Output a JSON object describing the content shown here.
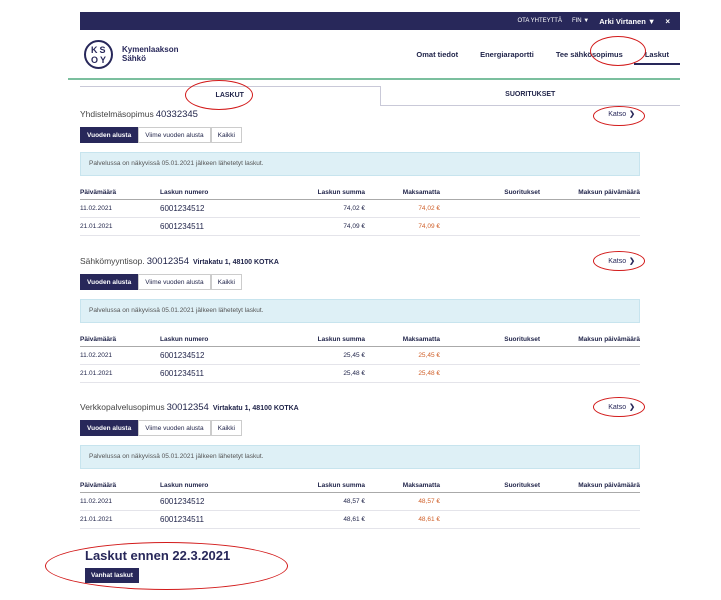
{
  "topbar": {
    "contact": "OTA YHTEYTTÄ",
    "lang": "FIN",
    "user": "Arki Virtanen",
    "close": "×"
  },
  "brand": {
    "logo_mark_top": "KS",
    "logo_mark_bottom": "OY",
    "name_line1": "Kymenlaakson",
    "name_line2": "Sähkö"
  },
  "nav": [
    "Omat tiedot",
    "Energiaraportti",
    "Tee sähkösopimus",
    "Laskut"
  ],
  "tabs": {
    "invoices": "LASKUT",
    "payments": "SUORITUKSET"
  },
  "icons": {
    "chevron": "chevron-down-icon",
    "caret": "caret-down-icon",
    "close": "close-icon"
  },
  "colors": {
    "brand": "#28285a",
    "accent_green": "#7bbf9e",
    "due": "#d0602a",
    "annotation": "#d21a1a",
    "info_bg": "#def0f6"
  },
  "filters": [
    "Vuoden alusta",
    "Viime vuoden alusta",
    "Kaikki"
  ],
  "columns": [
    "Päivämäärä",
    "Laskun numero",
    "Laskun summa",
    "Maksamatta",
    "Suoritukset",
    "Maksun päivämäärä"
  ],
  "katso": "Katso",
  "sections": [
    {
      "label": "Yhdistelmäsopimus",
      "number": "40332345",
      "address": "",
      "info": "Palvelussa on näkyvissä 05.01.2021 jälkeen lähetetyt laskut.",
      "rows": [
        {
          "date": "11.02.2021",
          "invoice": "6001234512",
          "sum": "74,02 €",
          "due": "74,02 €"
        },
        {
          "date": "21.01.2021",
          "invoice": "6001234511",
          "sum": "74,09 €",
          "due": "74,09 €"
        }
      ]
    },
    {
      "label": "Sähkömyyntisop.",
      "number": "30012354",
      "address": "Virtakatu 1, 48100 KOTKA",
      "info": "Palvelussa on näkyvissä 05.01.2021 jälkeen lähetetyt laskut.",
      "rows": [
        {
          "date": "11.02.2021",
          "invoice": "6001234512",
          "sum": "25,45 €",
          "due": "25,45 €"
        },
        {
          "date": "21.01.2021",
          "invoice": "6001234511",
          "sum": "25,48 €",
          "due": "25,48 €"
        }
      ]
    },
    {
      "label": "Verkkopalvelusopimus",
      "number": "30012354",
      "address": "Virtakatu 1, 48100 KOTKA",
      "info": "Palvelussa on näkyvissä 05.01.2021 jälkeen lähetetyt laskut.",
      "rows": [
        {
          "date": "11.02.2021",
          "invoice": "6001234512",
          "sum": "48,57 €",
          "due": "48,57 €"
        },
        {
          "date": "21.01.2021",
          "invoice": "6001234511",
          "sum": "48,61 €",
          "due": "48,61 €"
        }
      ]
    }
  ],
  "older": {
    "title": "Laskut ennen 22.3.2021",
    "button": "Vanhat laskut"
  }
}
